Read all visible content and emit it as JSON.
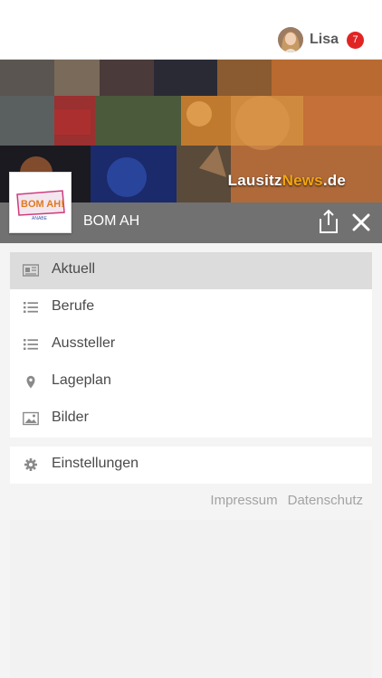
{
  "header": {
    "username": "Lisa",
    "notification_count": "7"
  },
  "banner": {
    "brand_part1": "Lausitz",
    "brand_part2": "News",
    "brand_part3": ".de"
  },
  "page": {
    "title": "BOM AH",
    "logo_text": "BOM AH!",
    "logo_subtext": "ANABE"
  },
  "menu": {
    "items": [
      {
        "label": "Aktuell",
        "icon": "newspaper-icon",
        "active": true
      },
      {
        "label": "Berufe",
        "icon": "list-icon",
        "active": false
      },
      {
        "label": "Aussteller",
        "icon": "list-icon",
        "active": false
      },
      {
        "label": "Lageplan",
        "icon": "map-pin-icon",
        "active": false
      },
      {
        "label": "Bilder",
        "icon": "image-icon",
        "active": false
      }
    ],
    "settings_label": "Einstellungen",
    "settings_icon": "gear-icon"
  },
  "footer": {
    "impressum": "Impressum",
    "datenschutz": "Datenschutz"
  },
  "colors": {
    "badge": "#e02424",
    "titlebar": "#717171",
    "brand_accent": "#f2a60f",
    "active_item": "#dcdcdc"
  }
}
